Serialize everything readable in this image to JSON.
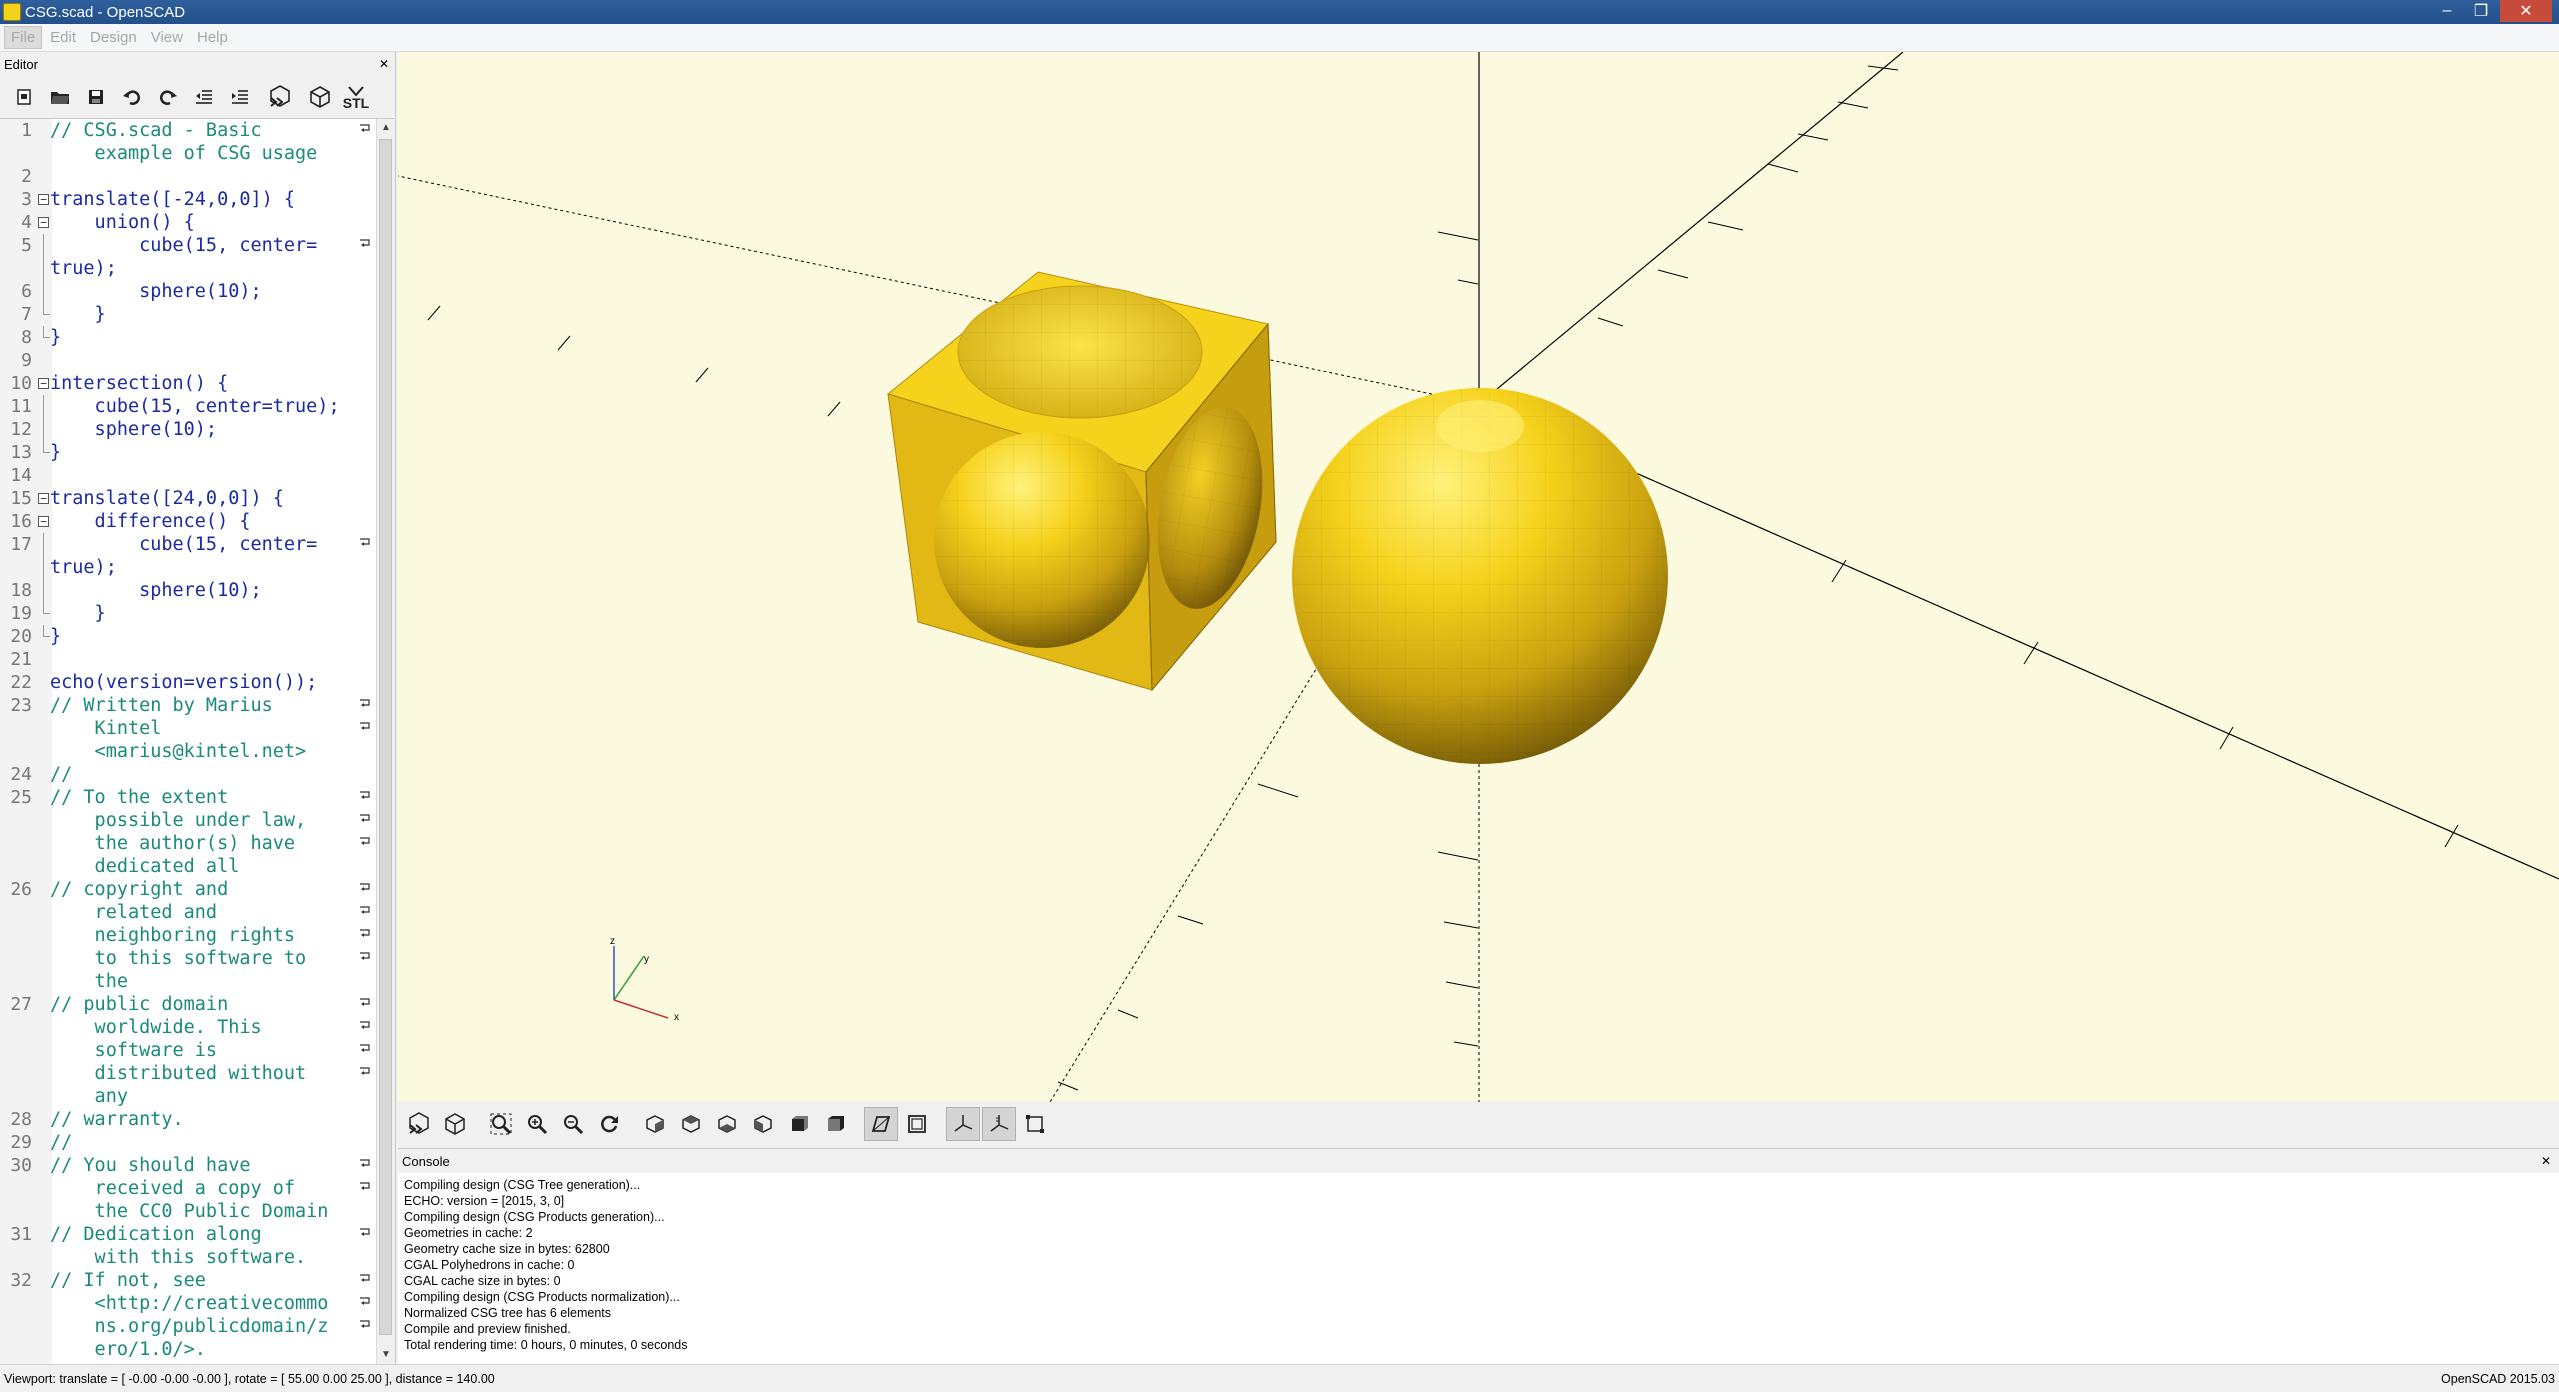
{
  "window": {
    "title": "CSG.scad - OpenSCAD",
    "minimize": "–",
    "restore": "❐",
    "close": "✕"
  },
  "menu": {
    "items": [
      "File",
      "Edit",
      "Design",
      "View",
      "Help"
    ]
  },
  "editor": {
    "title": "Editor",
    "close": "✕",
    "toolbar": {
      "new": "new-file-icon",
      "open": "open-folder-icon",
      "save": "save-icon",
      "undo": "undo-icon",
      "redo": "redo-icon",
      "unindent": "unindent-icon",
      "indent": "indent-icon",
      "preview": "preview-icon",
      "render": "render-icon",
      "stl_label": "STL"
    },
    "lines": [
      {
        "n": "1",
        "text": "// CSG.scad - Basic",
        "kind": "comment",
        "wrap": true
      },
      {
        "n": "",
        "text": "    example of CSG usage",
        "kind": "comment"
      },
      {
        "n": "2",
        "text": "",
        "kind": "default"
      },
      {
        "n": "3",
        "text": "translate([-24,0,0]) {",
        "kind": "default",
        "fold": "open"
      },
      {
        "n": "4",
        "text": "    union() {",
        "kind": "default",
        "fold": "open"
      },
      {
        "n": "5",
        "text": "        cube(15, center=",
        "kind": "default",
        "fold": "line",
        "wrap": true
      },
      {
        "n": "",
        "text": "true);",
        "kind": "default",
        "fold": "line"
      },
      {
        "n": "6",
        "text": "        sphere(10);",
        "kind": "default",
        "fold": "line"
      },
      {
        "n": "7",
        "text": "    }",
        "kind": "default",
        "fold": "end"
      },
      {
        "n": "8",
        "text": "}",
        "kind": "default",
        "fold": "end"
      },
      {
        "n": "9",
        "text": "",
        "kind": "default"
      },
      {
        "n": "10",
        "text": "intersection() {",
        "kind": "default",
        "fold": "open"
      },
      {
        "n": "11",
        "text": "    cube(15, center=true);",
        "kind": "default",
        "fold": "line"
      },
      {
        "n": "12",
        "text": "    sphere(10);",
        "kind": "default",
        "fold": "line"
      },
      {
        "n": "13",
        "text": "}",
        "kind": "default",
        "fold": "end"
      },
      {
        "n": "14",
        "text": "",
        "kind": "default"
      },
      {
        "n": "15",
        "text": "translate([24,0,0]) {",
        "kind": "default",
        "fold": "open"
      },
      {
        "n": "16",
        "text": "    difference() {",
        "kind": "default",
        "fold": "open"
      },
      {
        "n": "17",
        "text": "        cube(15, center=",
        "kind": "default",
        "fold": "line",
        "wrap": true
      },
      {
        "n": "",
        "text": "true);",
        "kind": "default",
        "fold": "line"
      },
      {
        "n": "18",
        "text": "        sphere(10);",
        "kind": "default",
        "fold": "line"
      },
      {
        "n": "19",
        "text": "    }",
        "kind": "default",
        "fold": "end"
      },
      {
        "n": "20",
        "text": "}",
        "kind": "default",
        "fold": "end"
      },
      {
        "n": "21",
        "text": "",
        "kind": "default"
      },
      {
        "n": "22",
        "text": "echo(version=version());",
        "kind": "default"
      },
      {
        "n": "23",
        "text": "// Written by Marius",
        "kind": "comment",
        "wrap": true
      },
      {
        "n": "",
        "text": "    Kintel",
        "kind": "comment",
        "wrap": true
      },
      {
        "n": "",
        "text": "    <marius@kintel.net>",
        "kind": "comment"
      },
      {
        "n": "24",
        "text": "//",
        "kind": "comment"
      },
      {
        "n": "25",
        "text": "// To the extent",
        "kind": "comment",
        "wrap": true
      },
      {
        "n": "",
        "text": "    possible under law,",
        "kind": "comment",
        "wrap": true
      },
      {
        "n": "",
        "text": "    the author(s) have",
        "kind": "comment",
        "wrap": true
      },
      {
        "n": "",
        "text": "    dedicated all",
        "kind": "comment"
      },
      {
        "n": "26",
        "text": "// copyright and",
        "kind": "comment",
        "wrap": true
      },
      {
        "n": "",
        "text": "    related and",
        "kind": "comment",
        "wrap": true
      },
      {
        "n": "",
        "text": "    neighboring rights",
        "kind": "comment",
        "wrap": true
      },
      {
        "n": "",
        "text": "    to this software to",
        "kind": "comment",
        "wrap": true
      },
      {
        "n": "",
        "text": "    the",
        "kind": "comment"
      },
      {
        "n": "27",
        "text": "// public domain",
        "kind": "comment",
        "wrap": true
      },
      {
        "n": "",
        "text": "    worldwide. This",
        "kind": "comment",
        "wrap": true
      },
      {
        "n": "",
        "text": "    software is",
        "kind": "comment",
        "wrap": true
      },
      {
        "n": "",
        "text": "    distributed without",
        "kind": "comment",
        "wrap": true
      },
      {
        "n": "",
        "text": "    any",
        "kind": "comment"
      },
      {
        "n": "28",
        "text": "// warranty.",
        "kind": "comment"
      },
      {
        "n": "29",
        "text": "//",
        "kind": "comment"
      },
      {
        "n": "30",
        "text": "// You should have",
        "kind": "comment",
        "wrap": true
      },
      {
        "n": "",
        "text": "    received a copy of",
        "kind": "comment",
        "wrap": true
      },
      {
        "n": "",
        "text": "    the CC0 Public Domain",
        "kind": "comment"
      },
      {
        "n": "31",
        "text": "// Dedication along",
        "kind": "comment",
        "wrap": true
      },
      {
        "n": "",
        "text": "    with this software.",
        "kind": "comment"
      },
      {
        "n": "32",
        "text": "// If not, see",
        "kind": "comment",
        "wrap": true
      },
      {
        "n": "",
        "text": "    <http://creativecommo",
        "kind": "comment",
        "wrap": true
      },
      {
        "n": "",
        "text": "    ns.org/publicdomain/z",
        "kind": "comment",
        "wrap": true
      },
      {
        "n": "",
        "text": "    ero/1.0/>.",
        "kind": "comment"
      }
    ]
  },
  "viewport": {
    "background": "#fcfade",
    "object_color": "#f5d21c",
    "axis_labels": {
      "x": "x",
      "y": "y",
      "z": "z"
    }
  },
  "view_toolbar": {
    "buttons": [
      "preview-icon",
      "render-icon",
      "view-all-icon",
      "zoom-in-icon",
      "zoom-out-icon",
      "reset-view-icon",
      "view-right-icon",
      "view-top-icon",
      "view-bottom-icon",
      "view-left-icon",
      "view-front-icon",
      "view-back-icon",
      "perspective-icon",
      "orthogonal-icon",
      "show-axes-icon",
      "show-scale-markers-icon",
      "show-edges-icon"
    ]
  },
  "console": {
    "title": "Console",
    "close": "✕",
    "lines": [
      "Compiling design (CSG Tree generation)...",
      "ECHO: version = [2015, 3, 0]",
      "Compiling design (CSG Products generation)...",
      "Geometries in cache: 2",
      "Geometry cache size in bytes: 62800",
      "CGAL Polyhedrons in cache: 0",
      "CGAL cache size in bytes: 0",
      "Compiling design (CSG Products normalization)...",
      "Normalized CSG tree has 6 elements",
      "Compile and preview finished.",
      "Total rendering time: 0 hours, 0 minutes, 0 seconds"
    ]
  },
  "status": {
    "viewport": "Viewport: translate = [ -0.00 -0.00 -0.00 ], rotate = [ 55.00 0.00 25.00 ], distance = 140.00",
    "version": "OpenSCAD 2015.03"
  }
}
